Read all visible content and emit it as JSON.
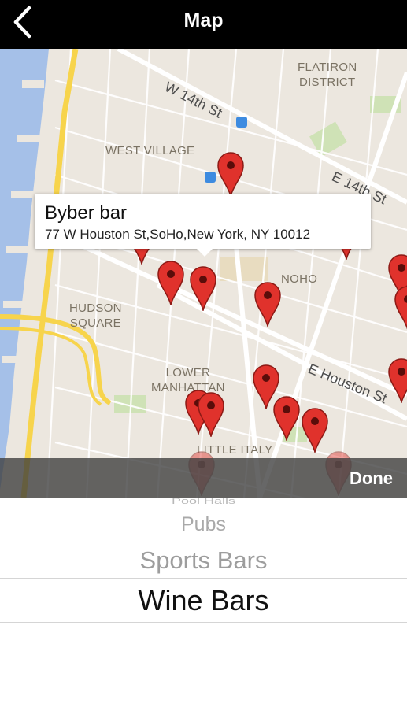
{
  "navbar": {
    "title": "Map",
    "back_icon": "chevron-left-icon"
  },
  "map": {
    "area_labels": [
      "FLATIRON\nDISTRICT",
      "WEST VILLAGE",
      "NOHO",
      "HUDSON\nSQUARE",
      "LOWER\nMANHATTAN",
      "LITTLE ITALY"
    ],
    "street_labels": [
      "W 14th St",
      "E 14th St",
      "E Houston St"
    ],
    "pin_color": "#e0322c",
    "water_color": "#a5c0e8",
    "highway_color": "#f7d44c"
  },
  "callout": {
    "name": "Byber bar",
    "address": "77 W Houston St,SoHo,New York, NY 10012"
  },
  "toolbar": {
    "done_label": "Done"
  },
  "picker": {
    "options": [
      "Pool Halls",
      "Pubs",
      "Sports Bars",
      "Wine Bars"
    ],
    "selected": "Wine Bars"
  }
}
